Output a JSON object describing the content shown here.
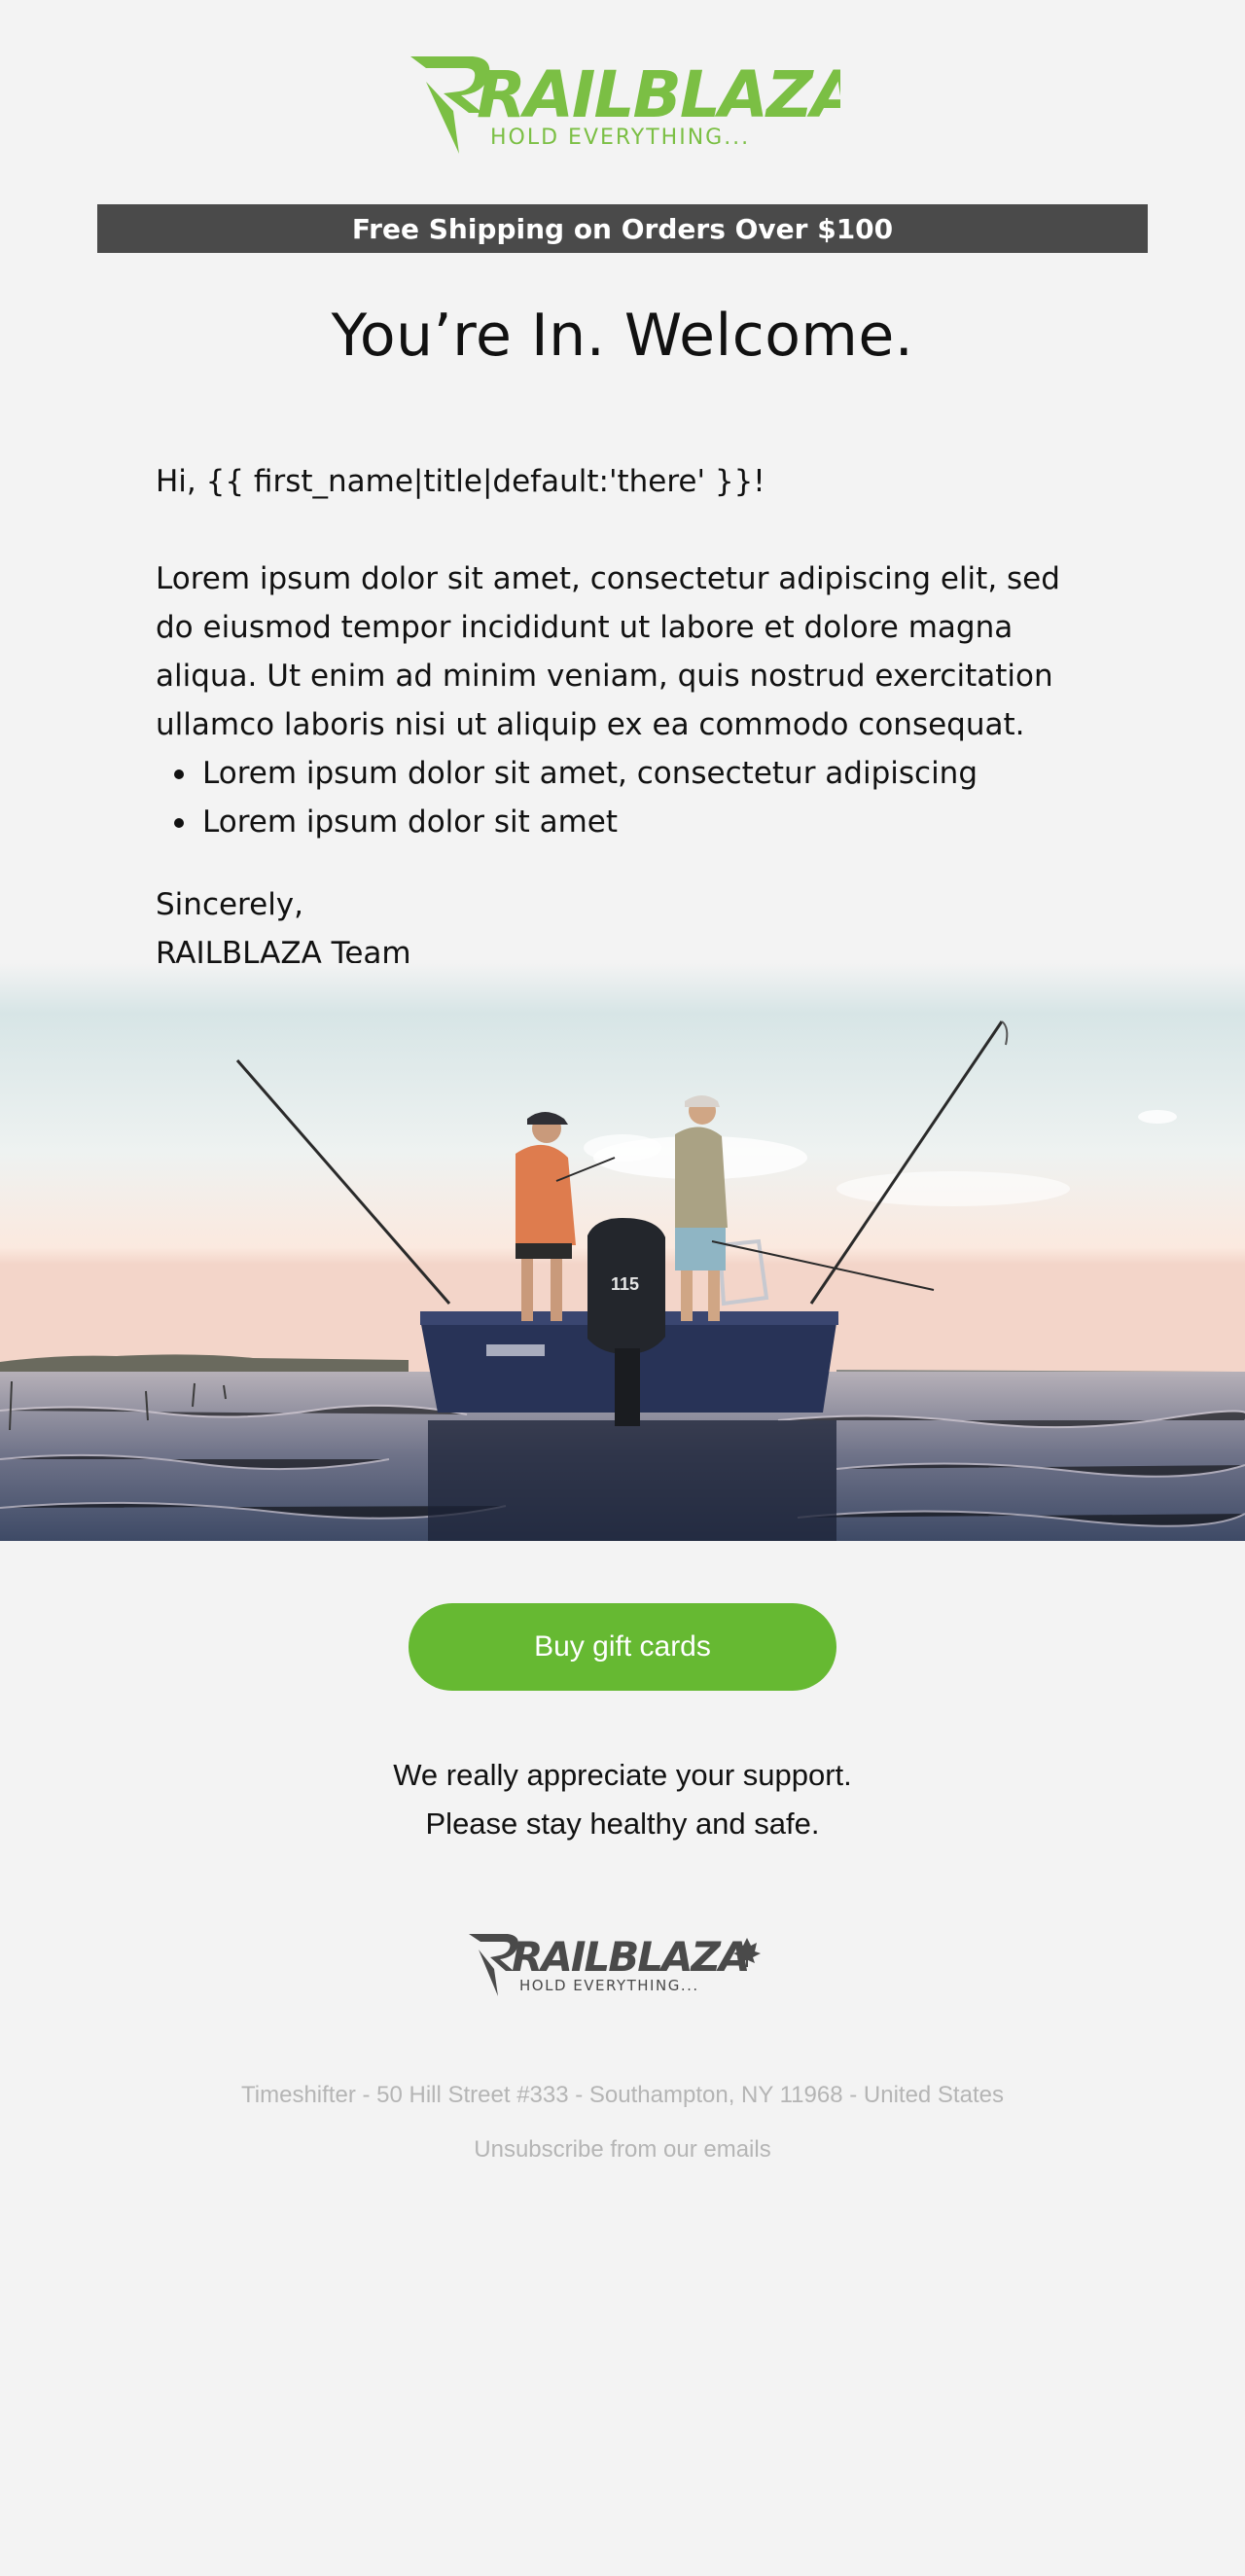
{
  "header": {
    "logo_text": "RAILBLAZA",
    "logo_tagline": "HOLD EVERYTHING...",
    "brand_color": "#7bbf44"
  },
  "banner": {
    "text": "Free Shipping on Orders Over $100",
    "background": "#4a4a4a"
  },
  "headline": "You’re In. Welcome.",
  "body": {
    "greeting": "Hi, {{ first_name|title|default:'there' }}!",
    "paragraph": "Lorem ipsum dolor sit amet, consectetur adipiscing elit, sed do eiusmod tempor incididunt ut labore et dolore magna aliqua. Ut enim ad minim veniam, quis nostrud exercitation ullamco laboris nisi ut aliquip ex ea commodo consequat.",
    "bullets": [
      "Lorem ipsum dolor sit amet, consectetur adipiscing",
      "Lorem ipsum dolor sit amet"
    ],
    "signoff_line1": "Sincerely,",
    "signoff_line2": "RAILBLAZA Team"
  },
  "hero": {
    "motor_label": "115"
  },
  "cta": {
    "label": "Buy gift cards",
    "color": "#66b932"
  },
  "support": {
    "line1": "We really appreciate your support.",
    "line2": "Please stay healthy and safe."
  },
  "footer": {
    "logo_text": "RAILBLAZA",
    "logo_tagline": "HOLD EVERYTHING...",
    "logo_icon": "maple-leaf-icon",
    "address": "Timeshifter - 50 Hill Street #333 - Southampton, NY 11968 - United States",
    "unsubscribe": "Unsubscribe from our emails",
    "muted_color": "#b5b5b5"
  }
}
